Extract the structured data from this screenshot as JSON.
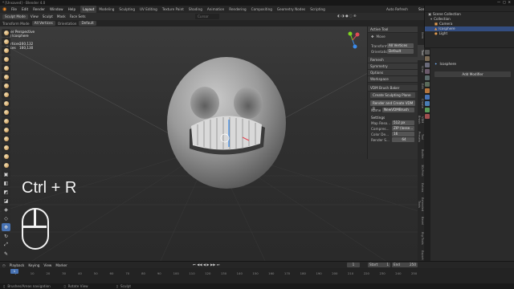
{
  "window": {
    "title": "* [Unsaved] - Blender 4.0"
  },
  "menu": {
    "items": [
      "File",
      "Edit",
      "Render",
      "Window",
      "Help"
    ],
    "workspaces": [
      "Layout",
      "Modeling",
      "Sculpting",
      "UV Editing",
      "Texture Paint",
      "Shading",
      "Animation",
      "Rendering",
      "Compositing",
      "Geometry Nodes",
      "Scripting"
    ],
    "active_workspace": "Layout",
    "scene_label": "Scene",
    "viewlayer_label": "ViewLayer",
    "auto_refresh": "Auto Refresh"
  },
  "header": {
    "mode": "Sculpt Mode",
    "view": "View",
    "sculpt": "Sculpt",
    "mask": "Mask",
    "face_sets": "Face Sets",
    "transform": "Transform Mode",
    "all_vertices": "All Vertices",
    "orientation_label": "Orientation",
    "orientation_value": "Default",
    "gizmo": "Cursor Gizmo"
  },
  "overlay": {
    "perspective": "User Perspective",
    "object": "(1) Icosphere",
    "vertices_label": "Vertices",
    "vertices_value": "160,132",
    "faces_label": "Faces",
    "faces_value": "160,130",
    "shortcut": "Ctrl + R"
  },
  "npanel": {
    "active_tool_title": "Active Tool",
    "move_tool": "Move",
    "transform_label": "Transform",
    "transform_value": "All Vertices",
    "orientation_label": "Orientation",
    "orientation_value": "Default",
    "remesh": "Remesh",
    "symmetry": "Symmetry",
    "options": "Options",
    "workspace": "Workspace",
    "vdm_title": "VDM Brush Baker",
    "create_plane": "Create Sculpting Plane",
    "render_create": "Render and Create VDM B...",
    "name_label": "Name",
    "name_value": "NewVDMBrush",
    "settings": "Settings",
    "map_res_label": "Map Reso...",
    "map_res_value": "512 px",
    "compress_label": "Compres...",
    "compress_value": "ZIP (losse...",
    "color_label": "Color De...",
    "color_value": "16",
    "render_samples_label": "Render S...",
    "render_samples_value": "64",
    "tabs": [
      "Item",
      "Tool",
      "View",
      "Edit",
      "Create",
      "VDM Brush",
      "Tool Presets",
      "Builtin",
      "3D-Print",
      "Extras",
      "Extended Tools",
      "Bevel",
      "Rig Tools",
      "Export"
    ]
  },
  "outliner": {
    "collection_root": "Scene Collection",
    "collection": "Collection",
    "items": [
      "Camera",
      "Icosphere",
      "Light"
    ],
    "selected": "Icosphere"
  },
  "properties": {
    "object_name": "Icosphere",
    "add_modifier": "Add Modifier"
  },
  "timeline": {
    "playback": "Playback",
    "keying": "Keying",
    "view": "View",
    "marker": "Marker",
    "current_frame": "1",
    "start_label": "Start",
    "start_value": "1",
    "end_label": "End",
    "end_value": "250",
    "ticks": [
      "1",
      "10",
      "20",
      "30",
      "40",
      "50",
      "60",
      "70",
      "80",
      "90",
      "100",
      "110",
      "120",
      "130",
      "140",
      "150",
      "160",
      "170",
      "180",
      "190",
      "200",
      "210",
      "220",
      "230",
      "240",
      "250"
    ]
  },
  "status": {
    "left": "Brushes/Areas navigation",
    "middle": "Rotate View",
    "right": "Sculpt"
  },
  "colors": {
    "accent": "#4772b3",
    "selection": "#334d80",
    "x_axis": "#e24a55",
    "y_axis": "#7ed321",
    "z_axis": "#3b8beb"
  }
}
